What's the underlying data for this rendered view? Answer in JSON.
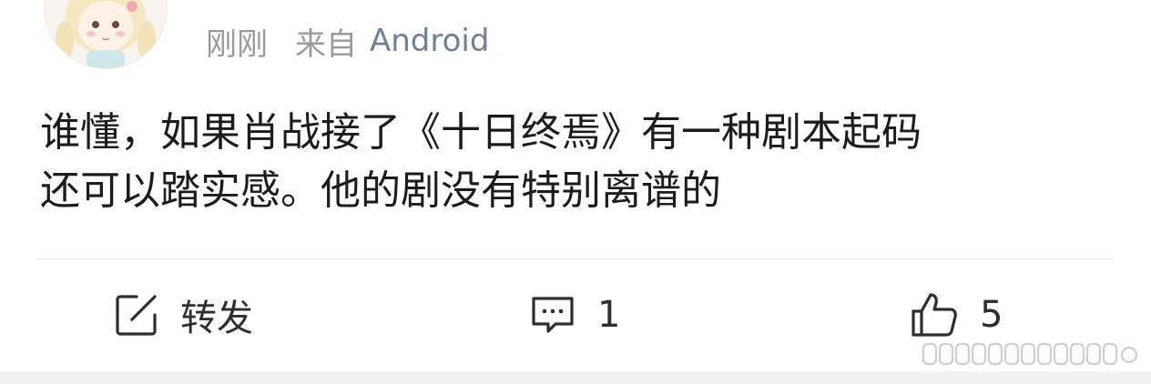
{
  "post": {
    "time": "刚刚",
    "source_prefix": "来自",
    "source_device": "Android",
    "content_lines": [
      "谁懂，如果肖战接了《十日终焉》有一种剧本起码",
      "还可以踏实感。他的剧没有特别离谱的"
    ]
  },
  "actions": {
    "repost_label": "转发",
    "repost_icon": "edit-square-icon",
    "comment_count": "1",
    "comment_icon": "comment-bubble-icon",
    "like_count": "5",
    "like_icon": "thumbs-up-icon"
  },
  "colors": {
    "meta_text": "#9a9a9a",
    "device_text": "#6f8198",
    "body_text": "#1c1c1c",
    "divider": "#e9e9e9"
  }
}
